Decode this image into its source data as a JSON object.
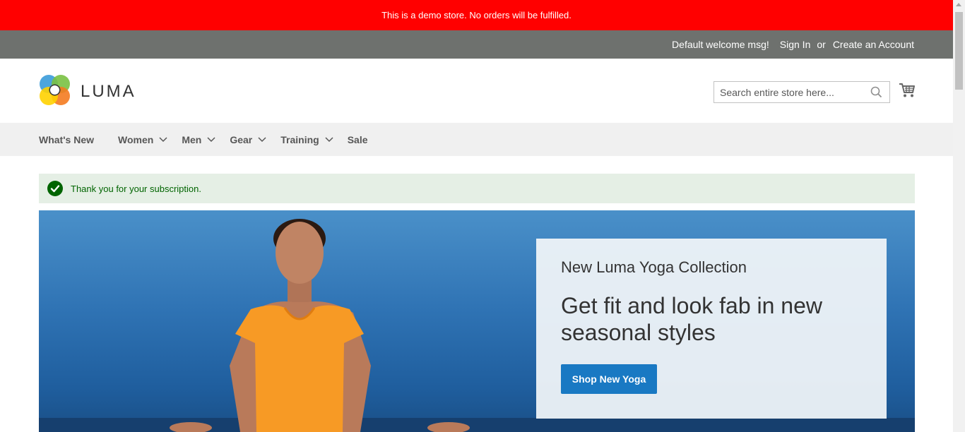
{
  "demo_notice": "This is a demo store. No orders will be fulfilled.",
  "panel": {
    "welcome": "Default welcome msg!",
    "sign_in": "Sign In",
    "or": "or",
    "create_account": "Create an Account"
  },
  "logo": {
    "text": "LUMA"
  },
  "search": {
    "placeholder": "Search entire store here...",
    "icon": "search-icon"
  },
  "cart": {
    "icon": "cart-icon"
  },
  "nav": {
    "items": [
      {
        "label": "What's New",
        "has_dropdown": false
      },
      {
        "label": "Women",
        "has_dropdown": true
      },
      {
        "label": "Men",
        "has_dropdown": true
      },
      {
        "label": "Gear",
        "has_dropdown": true
      },
      {
        "label": "Training",
        "has_dropdown": true
      },
      {
        "label": "Sale",
        "has_dropdown": false
      }
    ]
  },
  "message": {
    "text": "Thank you for your subscription.",
    "icon": "check-circle-icon"
  },
  "hero": {
    "subtitle": "New Luma Yoga Collection",
    "title": "Get fit and look fab in new seasonal styles",
    "button": "Shop New Yoga"
  },
  "colors": {
    "demo_bar": "#ff0000",
    "panel_bar": "#6e716e",
    "nav_bg": "#f0f0f0",
    "success_bg": "#e5efe5",
    "success_text": "#006400",
    "primary_button": "#1979c3"
  }
}
